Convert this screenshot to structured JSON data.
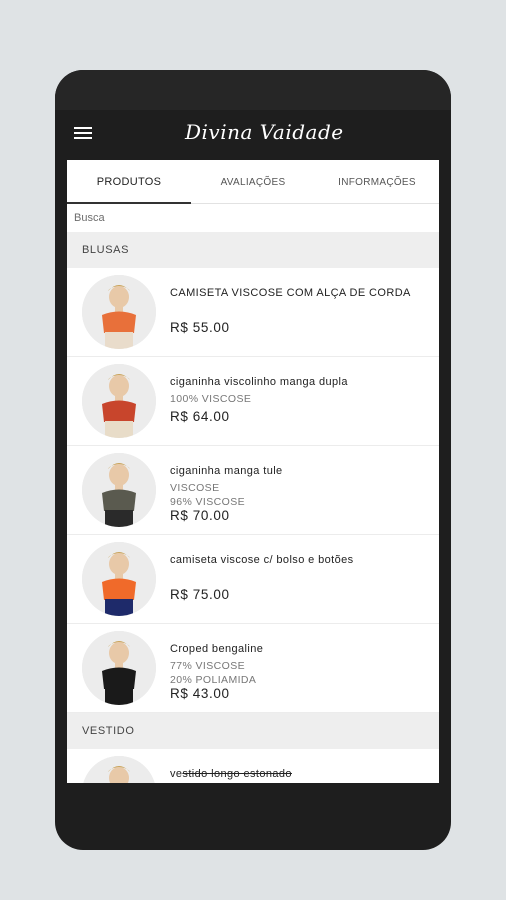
{
  "app": {
    "brand": "Divina Vaidade"
  },
  "tabs": [
    {
      "label": "PRODUTOS",
      "active": true
    },
    {
      "label": "AVALIAÇÕES",
      "active": false
    },
    {
      "label": "INFORMAÇÕES",
      "active": false
    }
  ],
  "search": {
    "placeholder": "Busca"
  },
  "sections": [
    {
      "title": "BLUSAS",
      "items": [
        {
          "name": "CAMISETA VISCOSE COM ALÇA DE CORDA",
          "desc": [],
          "price": "R$ 55.00",
          "top_color": "#e8703a",
          "bottom_color": "#e9dccb"
        },
        {
          "name": "ciganinha viscolinho manga dupla",
          "desc": [
            "100% VISCOSE"
          ],
          "price": "R$ 64.00",
          "top_color": "#c8452c",
          "bottom_color": "#e8dcc8"
        },
        {
          "name": "ciganinha manga tule",
          "desc": [
            "VISCOSE",
            "96% VISCOSE"
          ],
          "price": "R$ 70.00",
          "top_color": "#5a5a4f",
          "bottom_color": "#2a2a2a"
        },
        {
          "name": "camiseta viscose c/ bolso e botões",
          "desc": [],
          "price": "R$ 75.00",
          "top_color": "#f06a2a",
          "bottom_color": "#1e2a6a"
        },
        {
          "name": "Croped bengaline",
          "desc": [
            "77% VISCOSE",
            "20% POLIAMIDA"
          ],
          "price": "R$ 43.00",
          "top_color": "#1a1a1a",
          "bottom_color": "#1a1a1a"
        }
      ]
    },
    {
      "title": "VESTIDO",
      "items": [
        {
          "name_prefix": "ve",
          "name_strike": "stido longo estonado",
          "top_color": "#8a6a4a",
          "bottom_color": "#8a6a4a"
        }
      ]
    }
  ],
  "colors": {
    "phone": "#1e1e1e",
    "background": "#dfe3e5",
    "section_bg": "#eeeeee"
  },
  "icons": {
    "menu": "hamburger-menu-icon"
  }
}
